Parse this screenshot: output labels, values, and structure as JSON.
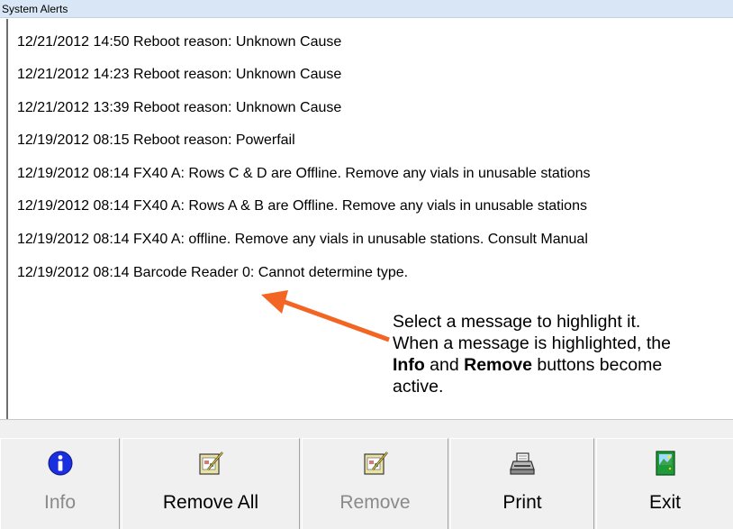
{
  "window": {
    "title": "System Alerts"
  },
  "alerts": [
    "12/21/2012 14:50 Reboot reason: Unknown Cause",
    "12/21/2012 14:23 Reboot reason: Unknown Cause",
    "12/21/2012 13:39 Reboot reason: Unknown Cause",
    "12/19/2012 08:15 Reboot reason: Powerfail",
    "12/19/2012 08:14 FX40 A: Rows C & D are Offline. Remove any vials in unusable stations",
    "12/19/2012 08:14 FX40 A: Rows A & B are Offline. Remove any vials in unusable stations",
    "12/19/2012 08:14 FX40 A: offline. Remove any vials in unusable stations. Consult Manual",
    "12/19/2012 08:14 Barcode Reader 0: Cannot determine type."
  ],
  "callout": {
    "line1": "Select a message to highlight it.",
    "line2": "When a message is highlighted, the",
    "info_word": "Info",
    "and_word": " and ",
    "remove_word": "Remove",
    "line3_rest": " buttons become",
    "line4": "active.",
    "arrow_color": "#f26522"
  },
  "toolbar": {
    "info": {
      "label": "Info",
      "icon": "info-icon",
      "enabled": false
    },
    "remove_all": {
      "label": "Remove All",
      "icon": "clipboard-pen-icon",
      "enabled": true
    },
    "remove": {
      "label": "Remove",
      "icon": "clipboard-pen-icon",
      "enabled": false
    },
    "print": {
      "label": "Print",
      "icon": "printer-icon",
      "enabled": true
    },
    "exit": {
      "label": "Exit",
      "icon": "exit-door-icon",
      "enabled": true
    }
  }
}
